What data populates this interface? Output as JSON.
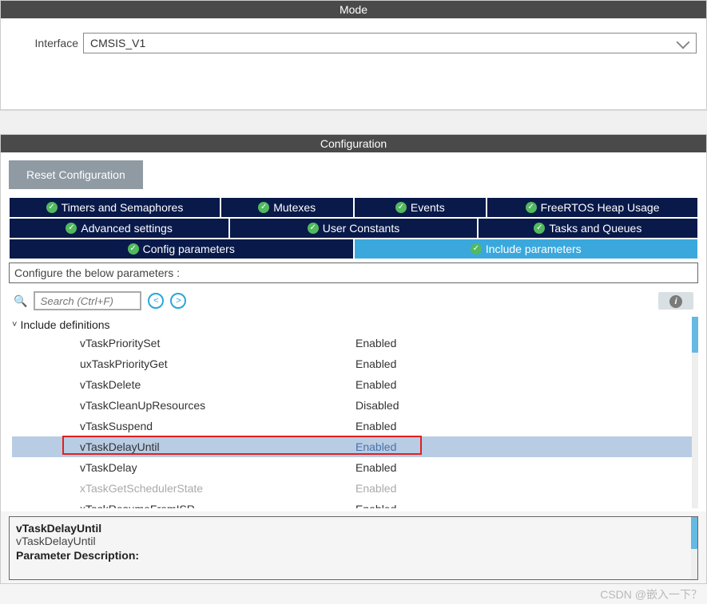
{
  "mode": {
    "header": "Mode",
    "interface_label": "Interface",
    "interface_value": "CMSIS_V1"
  },
  "configuration": {
    "header": "Configuration",
    "reset_btn": "Reset Configuration",
    "tabs_r1": [
      {
        "label": "Timers and Semaphores"
      },
      {
        "label": "Mutexes"
      },
      {
        "label": "Events"
      },
      {
        "label": "FreeRTOS Heap Usage"
      }
    ],
    "tabs_r2": [
      {
        "label": "Advanced settings"
      },
      {
        "label": "User Constants"
      },
      {
        "label": "Tasks and Queues"
      }
    ],
    "tabs_r3": {
      "config": "Config parameters",
      "include": "Include parameters"
    },
    "configure_label": "Configure the below parameters :",
    "search_placeholder": "Search (Ctrl+F)",
    "group_label": "Include definitions",
    "params": [
      {
        "name": "vTaskPrioritySet",
        "value": "Enabled",
        "disabled": false
      },
      {
        "name": "uxTaskPriorityGet",
        "value": "Enabled",
        "disabled": false
      },
      {
        "name": "vTaskDelete",
        "value": "Enabled",
        "disabled": false
      },
      {
        "name": "vTaskCleanUpResources",
        "value": "Disabled",
        "disabled": false
      },
      {
        "name": "vTaskSuspend",
        "value": "Enabled",
        "disabled": false
      },
      {
        "name": "vTaskDelayUntil",
        "value": "Enabled",
        "disabled": false,
        "selected": true,
        "highlighted": true
      },
      {
        "name": "vTaskDelay",
        "value": "Enabled",
        "disabled": false
      },
      {
        "name": "xTaskGetSchedulerState",
        "value": "Enabled",
        "disabled": true
      },
      {
        "name": "xTaskResumeFromISR",
        "value": "Enabled",
        "disabled": false
      }
    ],
    "description": {
      "title": "vTaskDelayUntil",
      "subtitle": "vTaskDelayUntil",
      "param_heading": "Parameter Description:"
    }
  },
  "watermark": "CSDN @嵌入一下？"
}
